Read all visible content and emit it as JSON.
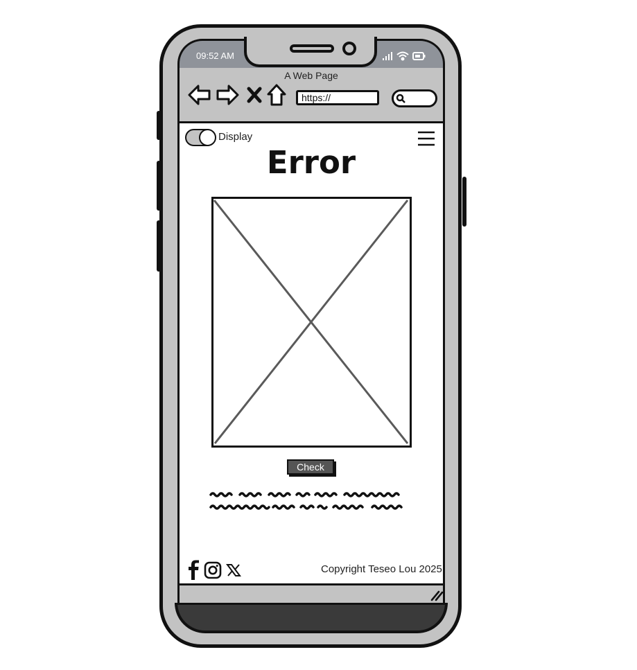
{
  "status_bar": {
    "time": "09:52 AM",
    "icons": [
      "signal-icon",
      "wifi-icon",
      "battery-icon"
    ]
  },
  "browser": {
    "page_title": "A Web Page",
    "url": "https://",
    "nav_icons": [
      "back-arrow-icon",
      "forward-arrow-icon",
      "close-icon",
      "home-icon",
      "search-icon"
    ]
  },
  "header": {
    "toggle_label": "Display",
    "menu_icon": "hamburger-menu-icon"
  },
  "main": {
    "title": "Error",
    "image": "image-placeholder",
    "check_button": "Check"
  },
  "footer": {
    "social_icons": [
      "facebook-icon",
      "instagram-icon",
      "x-icon"
    ],
    "copyright": "Copyright Teseo Lou 2025"
  },
  "colors": {
    "frame": "#c3c3c3",
    "status_bar": "#8f939a",
    "outline": "#111111",
    "button": "#555555",
    "chin": "#3a3a3a"
  }
}
